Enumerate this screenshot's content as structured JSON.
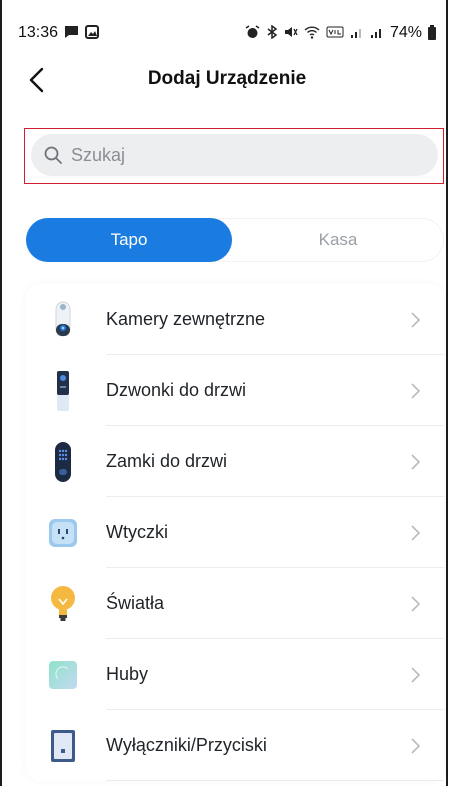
{
  "status_bar": {
    "time": "13:36",
    "battery": "74%"
  },
  "header": {
    "title": "Dodaj Urządzenie"
  },
  "search": {
    "placeholder": "Szukaj"
  },
  "tabs": [
    {
      "label": "Tapo",
      "active": true
    },
    {
      "label": "Kasa",
      "active": false
    }
  ],
  "categories": [
    {
      "label": "Kamery zewnętrzne",
      "icon": "outdoor-camera-icon"
    },
    {
      "label": "Dzwonki do drzwi",
      "icon": "doorbell-icon"
    },
    {
      "label": "Zamki do drzwi",
      "icon": "door-lock-icon"
    },
    {
      "label": "Wtyczki",
      "icon": "smart-plug-icon"
    },
    {
      "label": "Światła",
      "icon": "light-bulb-icon"
    },
    {
      "label": "Huby",
      "icon": "hub-icon"
    },
    {
      "label": "Wyłączniki/Przyciski",
      "icon": "switch-icon"
    }
  ],
  "colors": {
    "accent": "#1a7ce0",
    "highlight_border": "#cf1f2d",
    "search_bg": "#eceef0"
  }
}
